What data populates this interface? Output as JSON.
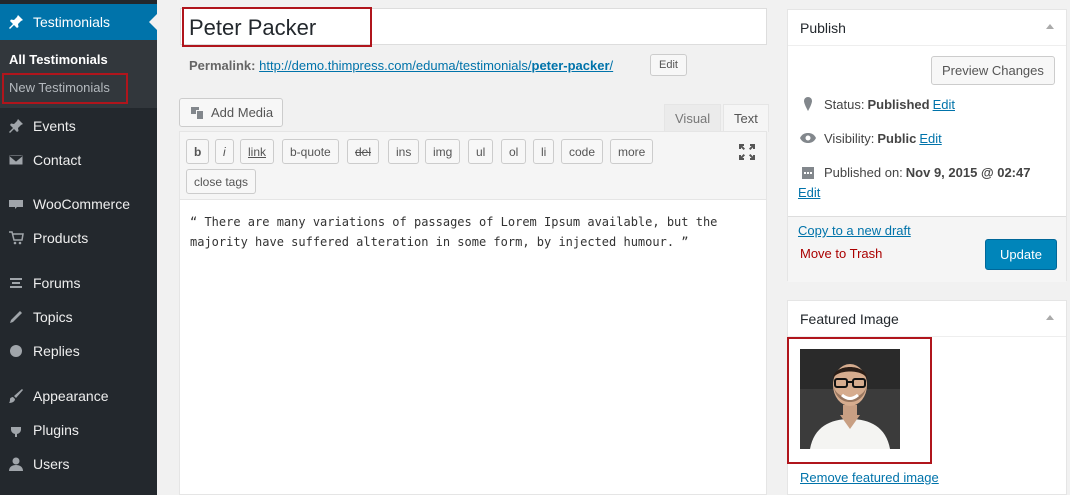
{
  "sidebar": {
    "current_label": "Testimonials",
    "submenu": {
      "all": "All Testimonials",
      "new": "New Testimonials"
    },
    "items": [
      {
        "label": "Events",
        "icon": "pushpin-icon"
      },
      {
        "label": "Contact",
        "icon": "envelope-icon"
      },
      {
        "label": "WooCommerce",
        "icon": "woocommerce-icon"
      },
      {
        "label": "Products",
        "icon": "cart-icon"
      },
      {
        "label": "Forums",
        "icon": "forums-icon"
      },
      {
        "label": "Topics",
        "icon": "topics-icon"
      },
      {
        "label": "Replies",
        "icon": "replies-icon"
      },
      {
        "label": "Appearance",
        "icon": "paintbrush-icon"
      },
      {
        "label": "Plugins",
        "icon": "plugin-icon"
      },
      {
        "label": "Users",
        "icon": "users-icon"
      }
    ]
  },
  "post": {
    "title": "Peter Packer",
    "permalink_label": "Permalink:",
    "permalink_base": "http://demo.thimpress.com/eduma/testimonials/",
    "permalink_slug": "peter-packer",
    "permalink_trailing": "/",
    "edit_label": "Edit"
  },
  "editor": {
    "add_media": "Add Media",
    "tab_visual": "Visual",
    "tab_text": "Text",
    "quicktags": [
      "b",
      "i",
      "link",
      "b-quote",
      "del",
      "ins",
      "img",
      "ul",
      "ol",
      "li",
      "code",
      "more"
    ],
    "close_tags": "close tags",
    "content_line1": "“ There are many variations of passages of Lorem Ipsum available, but the",
    "content_line2": "majority have suffered alteration in some form, by injected humour. ”"
  },
  "publish": {
    "title": "Publish",
    "preview": "Preview Changes",
    "status_label": "Status:",
    "status_value": "Published",
    "visibility_label": "Visibility:",
    "visibility_value": "Public",
    "published_label": "Published on:",
    "published_value": "Nov 9, 2015 @ 02:47",
    "edit": "Edit",
    "copy_draft": "Copy to a new draft",
    "trash": "Move to Trash",
    "update": "Update"
  },
  "featured": {
    "title": "Featured Image",
    "remove": "Remove featured image"
  },
  "colors": {
    "sidebar_bg": "#23282d",
    "accent": "#0073aa",
    "highlight_box": "#b0151c",
    "update_button": "#0085ba"
  }
}
